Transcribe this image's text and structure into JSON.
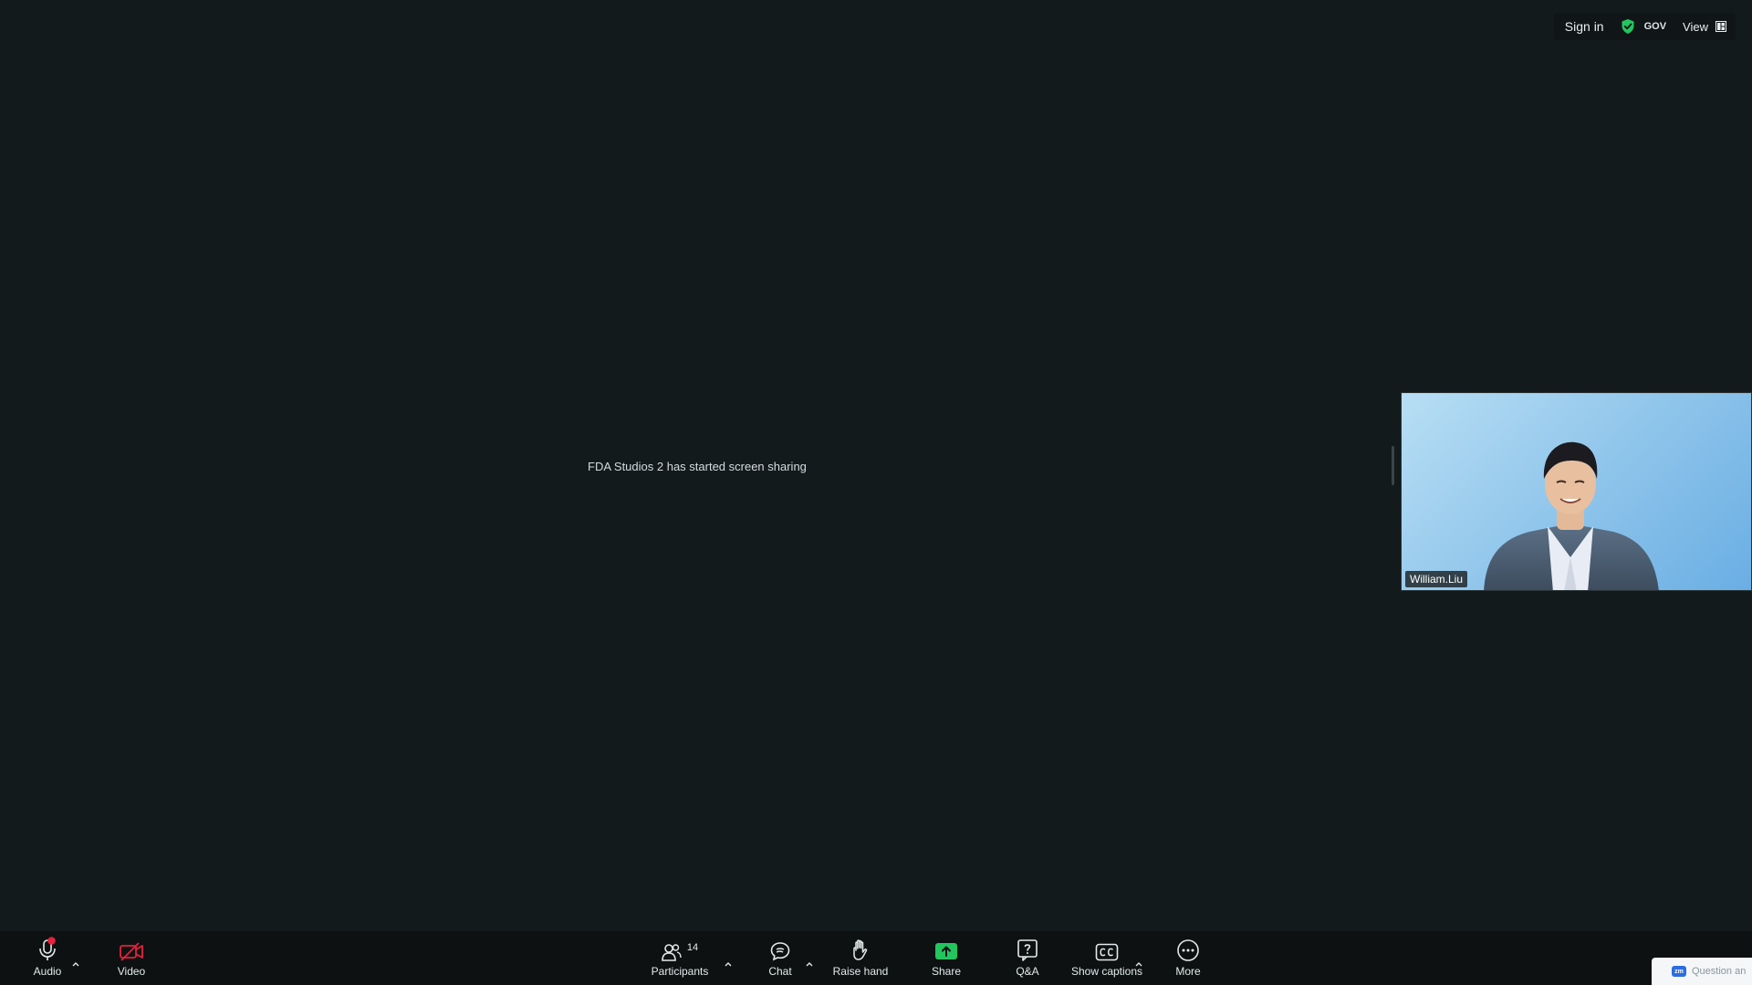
{
  "topbar": {
    "sign_in": "Sign in",
    "gov_badge": "GOV",
    "view_label": "View",
    "shield_color": "#22c55e"
  },
  "main": {
    "share_message": "FDA Studios 2 has started screen sharing"
  },
  "video": {
    "participant_name": "William.Liu"
  },
  "toolbar": {
    "audio": {
      "label": "Audio",
      "icon": "microphone-icon",
      "muted_dot_color": "#e5213c"
    },
    "video": {
      "label": "Video",
      "icon": "video-off-icon",
      "off_color": "#e5213c"
    },
    "participants": {
      "label": "Participants",
      "icon": "participants-icon",
      "count": "14"
    },
    "chat": {
      "label": "Chat",
      "icon": "chat-icon"
    },
    "raise_hand": {
      "label": "Raise hand",
      "icon": "hand-icon"
    },
    "share": {
      "label": "Share",
      "icon": "share-screen-icon",
      "color": "#22c55e"
    },
    "qa": {
      "label": "Q&A",
      "icon": "question-icon"
    },
    "captions": {
      "label": "Show captions",
      "icon": "cc-icon"
    },
    "more": {
      "label": "More",
      "icon": "more-icon"
    }
  },
  "notification": {
    "badge": "zm",
    "text": "Question an"
  }
}
